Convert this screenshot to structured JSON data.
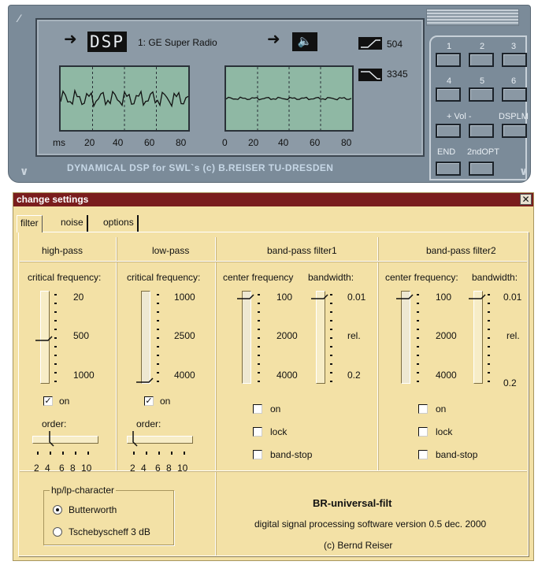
{
  "device": {
    "dsp_label": "DSP",
    "station": "1: GE Super Radio",
    "speaker_glyph": "🔈",
    "filter_value_top": "504",
    "filter_value_bottom": "3345",
    "left_axis": [
      "ms",
      "20",
      "40",
      "60",
      "80"
    ],
    "right_axis": [
      "0",
      "20",
      "40",
      "60",
      "80"
    ],
    "caption": "DYNAMICAL  DSP  for  SWL`s  (c) B.REISER TU-DRESDEN",
    "keys": [
      "1",
      "2",
      "3",
      "4",
      "5",
      "6"
    ],
    "vol_label": "+  Vol  -",
    "dsplm_label": "DSPLM",
    "end_label": "END",
    "second_opt_label": "2ndOPT"
  },
  "dialog": {
    "title": "change settings",
    "close_glyph": "✕",
    "tabs": [
      "filter",
      "noise",
      "options"
    ],
    "active_tab": "filter",
    "highpass": {
      "header": "high-pass",
      "sub": "critical frequency:",
      "values": [
        "20",
        "500",
        "1000"
      ],
      "level": 0.5,
      "on_label": "on",
      "on_checked": true,
      "order_label": "order:",
      "order_values": [
        "2",
        "4",
        "6",
        "8",
        "10"
      ],
      "order_selected": "4"
    },
    "lowpass": {
      "header": "low-pass",
      "sub": "critical frequency:",
      "values": [
        "1000",
        "2500",
        "4000"
      ],
      "level": 1.0,
      "on_label": "on",
      "on_checked": true,
      "order_label": "order:",
      "order_values": [
        "2",
        "4",
        "6",
        "8",
        "10"
      ],
      "order_selected": "2"
    },
    "bp1": {
      "header": "band-pass filter1",
      "center_label": "center frequency",
      "bandwidth_label": "bandwidth:",
      "center_values": [
        "100",
        "2000",
        "4000"
      ],
      "bandwidth_values": [
        "0.01",
        "rel.",
        "0.2"
      ],
      "center_level": 0.0,
      "bandwidth_level": 0.0,
      "on_label": "on",
      "lock_label": "lock",
      "bandstop_label": "band-stop"
    },
    "bp2": {
      "header": "band-pass filter2",
      "center_label": "center frequency:",
      "bandwidth_label": "bandwidth:",
      "center_values": [
        "100",
        "2000",
        "4000"
      ],
      "bandwidth_values": [
        "0.01",
        "rel.",
        "0.2"
      ],
      "center_level": 0.0,
      "bandwidth_level": 0.0,
      "on_label": "on",
      "lock_label": "lock",
      "bandstop_label": "band-stop"
    },
    "character": {
      "title": "hp/lp-character",
      "options": [
        "Butterworth",
        "Tschebyscheff 3 dB"
      ],
      "selected": "Butterworth"
    },
    "about": {
      "title": "BR-universal-filt",
      "line1": "digital signal processing software version 0.5 dec. 2000",
      "line2": "(c) Bernd Reiser"
    }
  }
}
